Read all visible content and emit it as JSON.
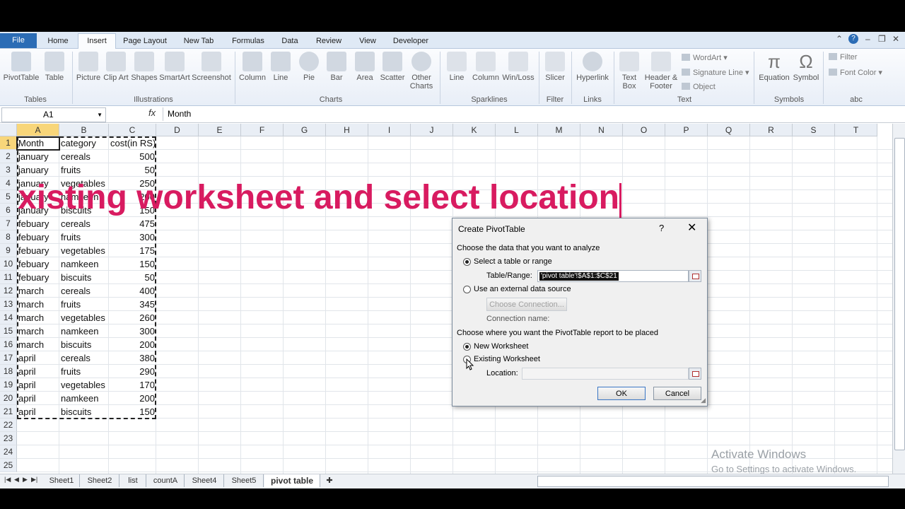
{
  "ribbon_tabs": [
    "File",
    "Home",
    "Insert",
    "Page Layout",
    "New Tab",
    "Formulas",
    "Data",
    "Review",
    "View",
    "Developer"
  ],
  "ribbon_buttons": {
    "pivottable": "PivotTable",
    "table": "Table",
    "picture": "Picture",
    "clip_art": "Clip Art",
    "shapes": "Shapes",
    "smartart": "SmartArt",
    "screenshot": "Screenshot",
    "column": "Column",
    "line": "Line",
    "pie": "Pie",
    "bar": "Bar",
    "area": "Area",
    "scatter": "Scatter",
    "other_charts": "Other Charts",
    "spark_line": "Line",
    "spark_column": "Column",
    "win_loss": "Win/Loss",
    "slicer": "Slicer",
    "hyperlink": "Hyperlink",
    "text_box": "Text Box",
    "header_footer": "Header & Footer",
    "wordart": "WordArt",
    "signature_line": "Signature Line",
    "object": "Object",
    "equation": "Equation",
    "symbol": "Symbol",
    "filter": "Filter",
    "font_color": "Font Color"
  },
  "ribbon_groups": {
    "tables": "Tables",
    "illustrations": "Illustrations",
    "charts": "Charts",
    "sparklines": "Sparklines",
    "filter": "Filter",
    "links": "Links",
    "text": "Text",
    "symbols": "Symbols",
    "abc": "abc"
  },
  "formula_bar": {
    "name_box": "A1",
    "fx": "fx",
    "value": "Month"
  },
  "columns": [
    "A",
    "B",
    "C",
    "D",
    "E",
    "F",
    "G",
    "H",
    "I",
    "J",
    "K",
    "L",
    "M",
    "N",
    "O",
    "P",
    "Q",
    "R",
    "S",
    "T"
  ],
  "rows": [
    "1",
    "2",
    "3",
    "4",
    "5",
    "6",
    "7",
    "8",
    "9",
    "10",
    "11",
    "12",
    "13",
    "14",
    "15",
    "16",
    "17",
    "18",
    "19",
    "20",
    "21",
    "22",
    "23",
    "24",
    "25"
  ],
  "table": [
    [
      "Month",
      "category",
      "cost(in RS)"
    ],
    [
      "january",
      "cereals",
      "500"
    ],
    [
      "january",
      "fruits",
      "50"
    ],
    [
      "january",
      "vegetables",
      "250"
    ],
    [
      "january",
      "namkeen",
      "200"
    ],
    [
      "january",
      "biscuits",
      "150"
    ],
    [
      "febuary",
      "cereals",
      "475"
    ],
    [
      "febuary",
      "fruits",
      "300"
    ],
    [
      "febuary",
      "vegetables",
      "175"
    ],
    [
      "febuary",
      "namkeen",
      "150"
    ],
    [
      "febuary",
      "biscuits",
      "50"
    ],
    [
      "march",
      "cereals",
      "400"
    ],
    [
      "march",
      "fruits",
      "345"
    ],
    [
      "march",
      "vegetables",
      "260"
    ],
    [
      "march",
      "namkeen",
      "300"
    ],
    [
      "march",
      "biscuits",
      "200"
    ],
    [
      "april",
      "cereals",
      "380"
    ],
    [
      "april",
      "fruits",
      "290"
    ],
    [
      "april",
      "vegetables",
      "170"
    ],
    [
      "april",
      "namkeen",
      "200"
    ],
    [
      "april",
      "biscuits",
      "150"
    ]
  ],
  "overlay_caption": "xisting worksheet and select location",
  "sheet_tabs": [
    "Sheet1",
    "Sheet2",
    "list",
    "countA",
    "Sheet4",
    "Sheet5",
    "pivot table"
  ],
  "active_sheet": "pivot table",
  "watermark": {
    "line1": "Activate Windows",
    "line2": "Go to Settings to activate Windows."
  },
  "dialog": {
    "title": "Create PivotTable",
    "help": "?",
    "close": "✕",
    "section1": "Choose the data that you want to analyze",
    "opt_select_range": "Select a table or range",
    "table_range_label": "Table/Range:",
    "table_range_value": "'pivot table'!$A$1:$C$21",
    "opt_external": "Use an external data source",
    "choose_connection": "Choose Connection...",
    "connection_name_label": "Connection name:",
    "section2": "Choose where you want the PivotTable report to be placed",
    "opt_new_ws": "New Worksheet",
    "opt_existing_ws": "Existing Worksheet",
    "location_label": "Location:",
    "location_value": "",
    "ok": "OK",
    "cancel": "Cancel",
    "selected_data_option": "Select a table or range",
    "selected_place_option": "New Worksheet"
  },
  "colors": {
    "accent": "#2b6cb5",
    "caption": "#d81b60",
    "selected_header": "#f8d67a"
  }
}
